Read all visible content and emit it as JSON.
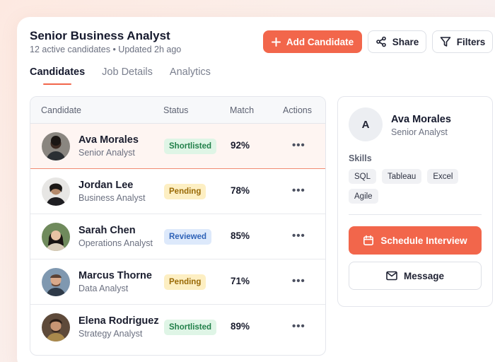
{
  "header": {
    "title": "Senior Business Analyst",
    "subtitle": "12 active candidates • Updated 2h ago",
    "add_label": "Add Candidate",
    "share_label": "Share",
    "filters_label": "Filters"
  },
  "tabs": [
    {
      "label": "Candidates"
    },
    {
      "label": "Job Details"
    },
    {
      "label": "Analytics"
    }
  ],
  "table": {
    "headers": {
      "candidate": "Candidate",
      "status": "Status",
      "match": "Match",
      "actions": "Actions"
    },
    "rows": [
      {
        "name": "Ava Morales",
        "role": "Senior Analyst",
        "status": "Shortlisted",
        "match": "92%",
        "actions": "•••"
      },
      {
        "name": "Jordan Lee",
        "role": "Business Analyst",
        "status": "Pending",
        "match": "78%",
        "actions": "•••"
      },
      {
        "name": "Sarah Chen",
        "role": "Operations Analyst",
        "status": "Reviewed",
        "match": "85%",
        "actions": "•••"
      },
      {
        "name": "Marcus Thorne",
        "role": "Data Analyst",
        "status": "Pending",
        "match": "71%",
        "actions": "•••"
      },
      {
        "name": "Elena Rodriguez",
        "role": "Strategy Analyst",
        "status": "Shortlisted",
        "match": "89%",
        "actions": "•••"
      }
    ]
  },
  "panel": {
    "initial": "A",
    "name": "Ava Morales",
    "role": "Senior Analyst",
    "skills_label": "Skills",
    "skills": [
      "SQL",
      "Tableau",
      "Excel",
      "Agile"
    ],
    "schedule_label": "Schedule Interview",
    "message_label": "Message"
  },
  "colors": {
    "accent": "#f2664b",
    "shortlisted_bg": "#dff5e6",
    "shortlisted_fg": "#22804a",
    "pending_bg": "#fdefc3",
    "pending_fg": "#9a6a06",
    "reviewed_bg": "#dde9fb",
    "reviewed_fg": "#2f63b8"
  }
}
